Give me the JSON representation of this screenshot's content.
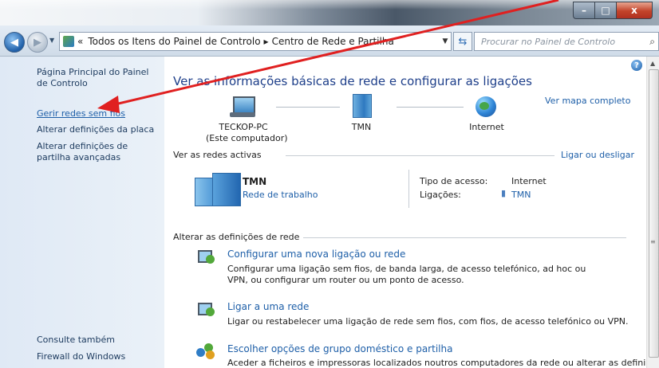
{
  "window": {
    "caption_buttons": {
      "minimize": "–",
      "maximize": "□",
      "close": "x"
    }
  },
  "nav": {
    "back_icon": "back-arrow-icon",
    "forward_icon": "forward-arrow-icon",
    "breadcrumb": {
      "prefix": "«",
      "items": [
        "Todos os Itens do Painel de Controlo",
        "Centro de Rede e Partilha"
      ],
      "separator": "▸"
    },
    "search_placeholder": "Procurar no Painel de Controlo"
  },
  "sidebar": {
    "home": "Página Principal do Painel de Controlo",
    "links": [
      "Gerir redes sem fios",
      "Alterar definições da placa",
      "Alterar definições de partilha avançadas"
    ],
    "see_also_title": "Consulte também",
    "see_also": [
      "Firewall do Windows"
    ]
  },
  "main": {
    "title": "Ver as informações básicas de rede e configurar as ligações",
    "full_map": "Ver mapa completo",
    "map_nodes": [
      {
        "label": "TECKOP-PC",
        "sub": "(Este computador)"
      },
      {
        "label": "TMN",
        "sub": ""
      },
      {
        "label": "Internet",
        "sub": ""
      }
    ],
    "active_networks": {
      "header": "Ver as redes activas",
      "connect_link": "Ligar ou desligar",
      "network_name": "TMN",
      "network_type": "Rede de trabalho",
      "access_type_label": "Tipo de acesso:",
      "access_type_value": "Internet",
      "connections_label": "Ligações:",
      "connections_value": "TMN"
    },
    "change_settings": {
      "header": "Alterar as definições de rede",
      "tasks": [
        {
          "title": "Configurar uma nova ligação ou rede",
          "desc": "Configurar uma ligação sem fios, de banda larga, de acesso telefónico, ad hoc ou VPN, ou configurar um router ou um ponto de acesso."
        },
        {
          "title": "Ligar a uma rede",
          "desc": "Ligar ou restabelecer uma ligação de rede sem fios, com fios, de acesso telefónico ou VPN."
        },
        {
          "title": "Escolher opções de grupo doméstico e partilha",
          "desc": "Aceder a ficheiros e impressoras localizados noutros computadores da rede ou alterar as definições"
        }
      ]
    }
  },
  "colors": {
    "link": "#1e5fa8",
    "title": "#1e3f8a",
    "annotation_arrow": "#e02020"
  }
}
